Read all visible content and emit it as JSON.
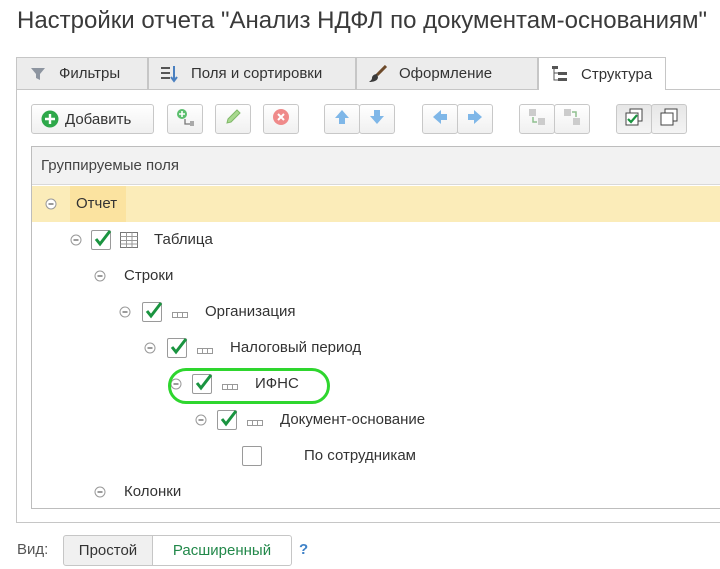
{
  "window": {
    "title": "Настройки отчета \"Анализ НДФЛ по документам-основаниям\""
  },
  "tabs": [
    {
      "label": "Фильтры",
      "icon": "funnel-icon",
      "active": false
    },
    {
      "label": "Поля и сортировки",
      "icon": "fields-sort-icon",
      "active": false
    },
    {
      "label": "Оформление",
      "icon": "brush-icon",
      "active": false
    },
    {
      "label": "Структура",
      "icon": "structure-icon",
      "active": true
    }
  ],
  "toolbar": {
    "add_label": "Добавить",
    "buttons": [
      "add-icon",
      "add-nested-icon",
      "edit-icon",
      "delete-icon",
      "move-up-icon",
      "move-down-icon",
      "move-left-icon",
      "move-right-icon",
      "group-icon",
      "ungroup-icon",
      "check-all-icon",
      "uncheck-all-icon"
    ]
  },
  "tree": {
    "header": "Группируемые поля",
    "rows": [
      {
        "label": "Отчет",
        "level": 0,
        "expanded": true,
        "checkbox": null,
        "icon": null,
        "selected": true
      },
      {
        "label": "Таблица",
        "level": 1,
        "expanded": true,
        "checkbox": true,
        "icon": "table-icon"
      },
      {
        "label": "Строки",
        "level": 2,
        "expanded": true,
        "checkbox": null,
        "icon": null
      },
      {
        "label": "Организация",
        "level": 3,
        "expanded": true,
        "checkbox": true,
        "icon": "field-icon"
      },
      {
        "label": "Налоговый период",
        "level": 4,
        "expanded": true,
        "checkbox": true,
        "icon": "field-icon"
      },
      {
        "label": "ИФНС",
        "level": 5,
        "expanded": true,
        "checkbox": true,
        "icon": "field-icon",
        "highlighted": true
      },
      {
        "label": "Документ-основание",
        "level": 6,
        "expanded": true,
        "checkbox": true,
        "icon": "field-icon"
      },
      {
        "label": "По сотрудникам",
        "level": 7,
        "expanded": false,
        "checkbox": false,
        "icon": null
      },
      {
        "label": "Колонки",
        "level": 2,
        "expanded": true,
        "checkbox": null,
        "icon": null
      }
    ]
  },
  "footer": {
    "view_label": "Вид:",
    "mode_simple": "Простой",
    "mode_extended": "Расширенный",
    "help": "?"
  },
  "colors": {
    "check": "#1a9440",
    "selected_row": "#fbecb9",
    "highlight_ring": "#2ed62e",
    "link_green": "#22884a",
    "help_blue": "#3f82c8"
  }
}
